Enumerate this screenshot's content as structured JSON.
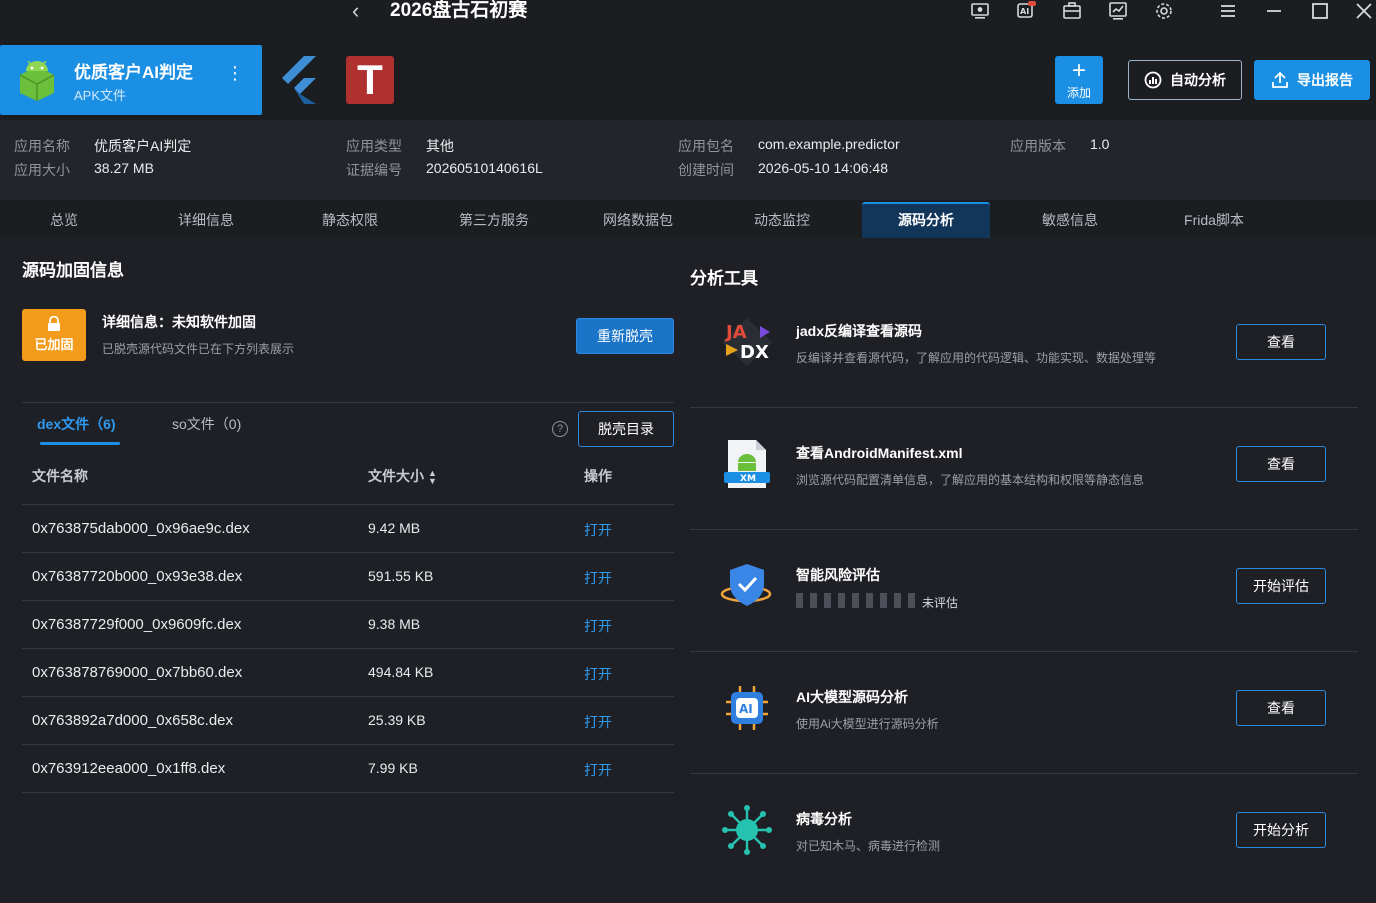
{
  "window": {
    "title": "2026盘古石初赛",
    "back_icon": "chevron-left-icon"
  },
  "titlebar_icons": [
    "screen-record-icon",
    "ai-new-icon",
    "toolbox-icon",
    "chart-icon",
    "gear-icon",
    "menu-icon",
    "minimize-icon",
    "maximize-icon",
    "close-icon"
  ],
  "app_card": {
    "name": "优质客户AI判定",
    "type": "APK文件",
    "more": "⋮"
  },
  "frameworks": {
    "t_letter": "T"
  },
  "header_buttons": {
    "add": "添加",
    "add_symbol": "+",
    "auto": "自动分析",
    "export": "导出报告"
  },
  "info": {
    "app_name_label": "应用名称",
    "app_name": "优质客户AI判定",
    "app_size_label": "应用大小",
    "app_size": "38.27 MB",
    "app_type_label": "应用类型",
    "app_type": "其他",
    "evidence_label": "证据编号",
    "evidence": "20260510140616L",
    "package_label": "应用包名",
    "package": "com.example.predictor",
    "created_label": "创建时间",
    "created": "2026-05-10 14:06:48",
    "version_label": "应用版本",
    "version": "1.0"
  },
  "tabs": [
    "总览",
    "详细信息",
    "静态权限",
    "第三方服务",
    "网络数据包",
    "动态监控",
    "源码分析",
    "敏感信息",
    "Frida脚本"
  ],
  "active_tab": "源码分析",
  "packing": {
    "title": "源码加固信息",
    "badge": "已加固",
    "detail": "详细信息：未知软件加固",
    "sub": "已脱壳源代码文件已在下方列表展示",
    "reshell_button": "重新脱壳"
  },
  "files": {
    "tab_dex": "dex文件（6)",
    "tab_so": "so文件（0)",
    "help": "?",
    "dir_button": "脱壳目录",
    "headers": {
      "name": "文件名称",
      "size": "文件大小",
      "action": "操作"
    },
    "rows": [
      {
        "name": "0x763875dab000_0x96ae9c.dex",
        "size": "9.42 MB",
        "action": "打开"
      },
      {
        "name": "0x76387720b000_0x93e38.dex",
        "size": "591.55 KB",
        "action": "打开"
      },
      {
        "name": "0x76387729f000_0x9609fc.dex",
        "size": "9.38 MB",
        "action": "打开"
      },
      {
        "name": "0x763878769000_0x7bb60.dex",
        "size": "494.84 KB",
        "action": "打开"
      },
      {
        "name": "0x763892a7d000_0x658c.dex",
        "size": "25.39 KB",
        "action": "打开"
      },
      {
        "name": "0x763912eea000_0x1ff8.dex",
        "size": "7.99 KB",
        "action": "打开"
      }
    ]
  },
  "tools": {
    "title": "分析工具",
    "items": [
      {
        "name": "jadx反编译查看源码",
        "desc": "反编译并查看源代码，了解应用的代码逻辑、功能实现、数据处理等",
        "button": "查看",
        "icon": "jadx-icon"
      },
      {
        "name": "查看AndroidManifest.xml",
        "desc": "浏览源代码配置清单信息，了解应用的基本结构和权限等静态信息",
        "button": "查看",
        "icon": "xml-file-icon"
      },
      {
        "name": "智能风险评估",
        "desc": "",
        "status": "未评估",
        "progress": 0,
        "button": "开始评估",
        "icon": "shield-check-icon"
      },
      {
        "name": "AI大模型源码分析",
        "desc": "使用Ai大模型进行源码分析",
        "button": "查看",
        "icon": "ai-chip-icon"
      },
      {
        "name": "病毒分析",
        "desc": "对已知木马、病毒进行检测",
        "button": "开始分析",
        "icon": "virus-icon"
      }
    ]
  }
}
